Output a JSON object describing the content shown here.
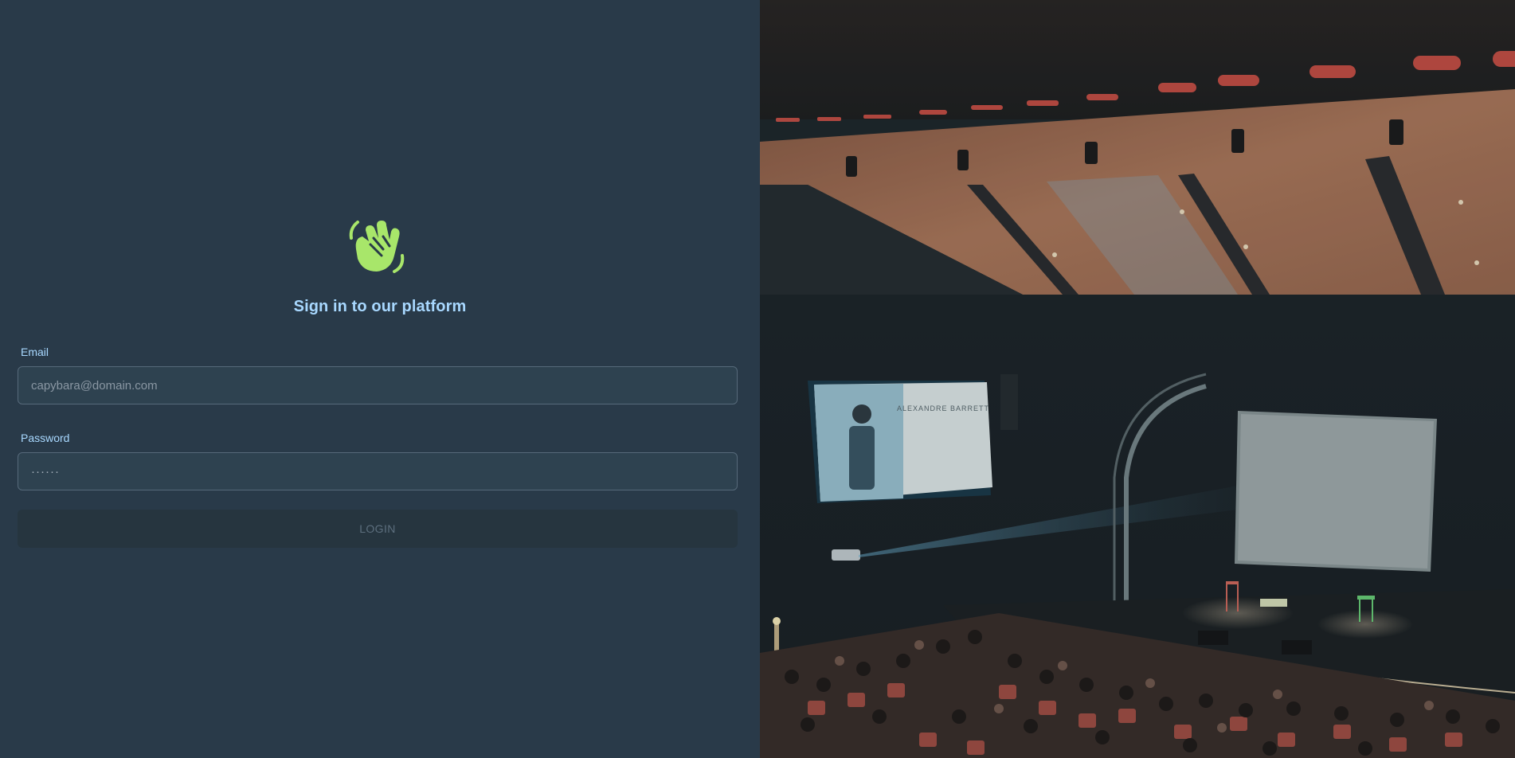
{
  "logo": {
    "icon": "waving-hand-icon",
    "color": "#a8e66a"
  },
  "title": "Sign in to our platform",
  "form": {
    "email_label": "Email",
    "email_placeholder": "capybara@domain.com",
    "password_label": "Password",
    "password_value": "······",
    "login_label": "LOGIN"
  },
  "photo": {
    "subject": "auditorium-presentation-photo",
    "screen_text": "ALEXANDRE BARRETT"
  },
  "colors": {
    "panel_background": "#293a49",
    "accent_text": "#a8d8ff",
    "logo_green": "#a8e66a",
    "input_background": "#2e4250",
    "input_border": "#56697a",
    "button_background": "#26353f",
    "button_text": "#5d6f7e"
  }
}
